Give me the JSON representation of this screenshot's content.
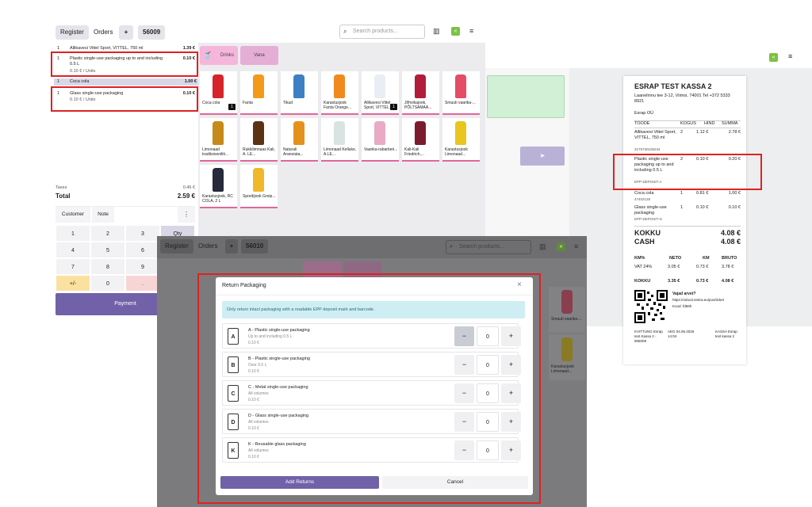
{
  "pos": {
    "tabs": {
      "register": "Register",
      "orders": "Orders",
      "add": "+",
      "ticket_no": "56009"
    },
    "search_placeholder": "Search products...",
    "ticket_lines": [
      {
        "qty": "1",
        "name": "Allikavesi Vittel Sport, VITTEL, 750 ml",
        "price": "1.39 €",
        "sub": ""
      },
      {
        "qty": "1",
        "name": "Plastic single-use packaging up to and including 0.5 L",
        "price": "0.10 €",
        "sub": "0.10 € / Units"
      },
      {
        "qty": "1",
        "name": "Coca cola",
        "price": "1.00 €",
        "sub": ""
      },
      {
        "qty": "1",
        "name": "Glass single-use packaging",
        "price": "0.10 €",
        "sub": "0.10 € / Units"
      }
    ],
    "taxes_label": "Taxes",
    "taxes_value": "0.46 €",
    "total_label": "Total",
    "total_value": "2.59 €",
    "customer_btn": "Customer",
    "note_btn": "Note",
    "more_btn": "⋮",
    "keypad": [
      "1",
      "2",
      "3",
      "Qty",
      "4",
      "5",
      "6",
      "",
      "7",
      "8",
      "9",
      "",
      "+/-",
      "0",
      "."
    ],
    "payment_btn": "Payment",
    "categories": [
      "Drinks",
      "Vana"
    ],
    "products": [
      {
        "name": "Coca cola",
        "color": "#d6242b",
        "badge": "1"
      },
      {
        "name": "Fanta",
        "color": "#f39a1a",
        "badge": ""
      },
      {
        "name": "Tikud",
        "color": "#3d7fc4",
        "badge": ""
      },
      {
        "name": "Karastusjook Fanta Orange...",
        "color": "#f08a1e",
        "badge": ""
      },
      {
        "name": "Allikavesi Vittel Sport, VITTEL...",
        "color": "#e9eef5",
        "badge": "1"
      },
      {
        "name": "Jõhvikajook, PÕLTSAMAA...",
        "color": "#b11c3a",
        "badge": ""
      },
      {
        "name": "Smuuti vaarika-...",
        "color": "#e54d67",
        "badge": ""
      },
      {
        "name": "Limonaad traditsiooniliti...",
        "color": "#c58a1a",
        "badge": ""
      },
      {
        "name": "Rukkilimnaas Kali, A. LE...",
        "color": "#5b3214",
        "badge": ""
      },
      {
        "name": "Naturali Aranoiata...",
        "color": "#e5921c",
        "badge": ""
      },
      {
        "name": "Limonaad Kelluke, A.LE...",
        "color": "#d9e4e2",
        "badge": ""
      },
      {
        "name": "Vaarika-rabarberi...",
        "color": "#e8aac4",
        "badge": ""
      },
      {
        "name": "Kali-Kali Friedrich,...",
        "color": "#7a1c2e",
        "badge": ""
      },
      {
        "name": "Karastusjook Limonaad...",
        "color": "#e8c61e",
        "badge": ""
      },
      {
        "name": "Karastusjook, RC COLA, 2 L",
        "color": "#262a3a",
        "badge": ""
      },
      {
        "name": "Spordijook Greip...",
        "color": "#f0b82a",
        "badge": ""
      }
    ]
  },
  "receipt": {
    "shop": "ESRAP TEST KASSA 2",
    "address": "Laanelinnu tee 3-12, Viimsi, 74001 Tel +372 5333 8921",
    "company": "Esrap OÜ",
    "headers": [
      "TOODE",
      "KOGUS",
      "HIND",
      "SUMMA"
    ],
    "lines": [
      {
        "name": "Allikavesi Vittel Sport, VITTEL, 750 ml",
        "code": "3179730106234",
        "qty": "2",
        "price": "1.12 €",
        "sum": "2.78 €"
      },
      {
        "name": "Plastic single-use packaging up to and including 0.5 L",
        "code": "EPP-DEPOSIT-A",
        "qty": "2",
        "price": "0.10 €",
        "sum": "0.20 €"
      },
      {
        "name": "Coca cola",
        "code": "47402128",
        "qty": "1",
        "price": "0.81 €",
        "sum": "1.00 €"
      },
      {
        "name": "Glass single-use packaging",
        "code": "EPP-DEPOSIT-G",
        "qty": "1",
        "price": "0.10 €",
        "sum": "0.10 €"
      }
    ],
    "kokku_label": "KOKKU",
    "kokku_value": "4.08 €",
    "cash_label": "CASH",
    "cash_value": "4.08 €",
    "tax_headers": [
      "KM%",
      "NETO",
      "KM",
      "BRUTO"
    ],
    "tax_row": [
      "VAT 24%",
      "3.05 €",
      "0.73 €",
      "3.78 €"
    ],
    "tax_total": [
      "KOKKU",
      "3.35 €",
      "0.73 €",
      "4.08 €"
    ],
    "qr_text1": "Vajad arvet?",
    "qr_text2": "https://odoo2.testra.eu/pos/ticket",
    "qr_text3": "Kood: fd68h",
    "footer": [
      "KVITTUNG Esrap test Kassa 2 - 905009",
      "AEG 04.06.2026 14:04",
      "KASSA Esrap test kassa 2"
    ]
  },
  "second": {
    "tabs": {
      "register": "Register",
      "orders": "Orders",
      "add": "+",
      "ticket_no": "56010"
    },
    "search_placeholder": "Search products...",
    "side_products": [
      "Smuuti vaarika-...",
      "Karastusjook Limonaad..."
    ]
  },
  "modal": {
    "title": "Return Packaging",
    "close": "×",
    "notice": "Only return intact packaging with a readable EPP deposit mark and barcode.",
    "rows": [
      {
        "code": "A",
        "title": "A - Plastic single-use packaging",
        "desc": "Up to and including 0.5 L",
        "price": "0.10 €",
        "qty": "0"
      },
      {
        "code": "B",
        "title": "B - Plastic single-use packaging",
        "desc": "Over 0.5 L",
        "price": "0.10 €",
        "qty": "0"
      },
      {
        "code": "C",
        "title": "C - Metal single-use packaging",
        "desc": "All volumes",
        "price": "0.10 €",
        "qty": "0"
      },
      {
        "code": "D",
        "title": "D - Glass single-use packaging",
        "desc": "All volumes",
        "price": "0.10 €",
        "qty": "0"
      },
      {
        "code": "K",
        "title": "K - Reusable glass packaging",
        "desc": "All volumes",
        "price": "0.10 €",
        "qty": "0"
      }
    ],
    "minus": "−",
    "plus": "+",
    "add_btn": "Add Returns",
    "cancel_btn": "Cancel"
  },
  "colors": {
    "accent": "#7161a8",
    "highlight": "#dd2222",
    "pink": "#f4b6da"
  }
}
